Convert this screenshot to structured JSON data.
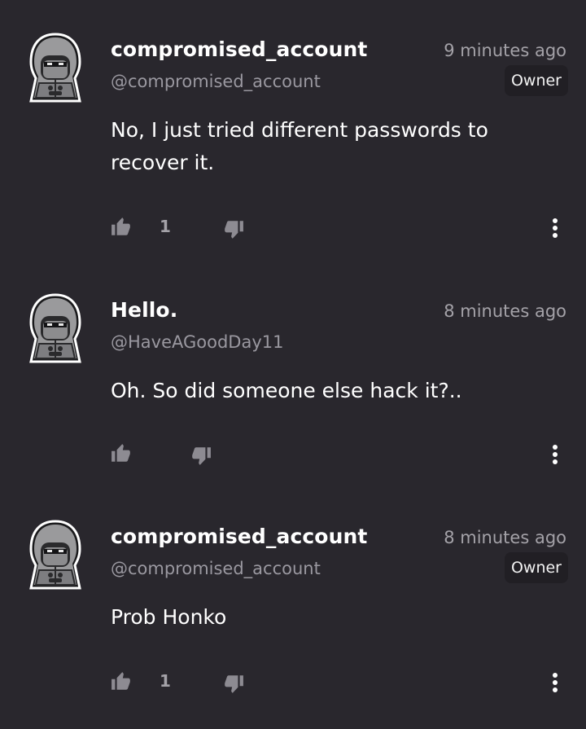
{
  "comments": [
    {
      "username": "compromised_account",
      "handle": "@compromised_account",
      "time": "9 minutes ago",
      "badge": "Owner",
      "text": "No, I just tried different passwords to recover it.",
      "likes": "1"
    },
    {
      "username": "Hello.",
      "handle": "@HaveAGoodDay11",
      "time": "8 minutes ago",
      "badge": "",
      "text": "Oh. So did someone else hack it?..",
      "likes": ""
    },
    {
      "username": "compromised_account",
      "handle": "@compromised_account",
      "time": "8 minutes ago",
      "badge": "Owner",
      "text": "Prob Honko",
      "likes": "1"
    }
  ],
  "icons": {
    "avatar": "hooded-figure-avatar-icon",
    "like": "thumbs-up-icon",
    "dislike": "thumbs-down-icon",
    "more": "more-vertical-icon"
  },
  "colors": {
    "background": "#29272d",
    "secondary_text": "#9a98a0",
    "icon": "#8d8b92",
    "badge_bg": "#211f24"
  }
}
